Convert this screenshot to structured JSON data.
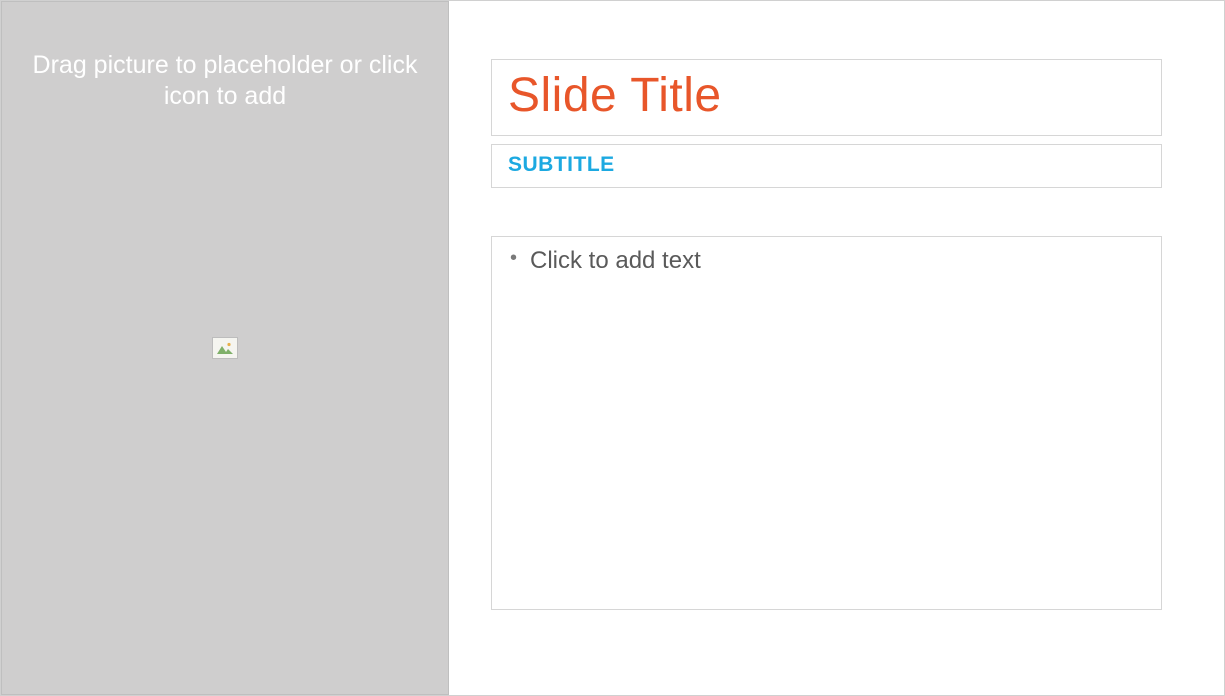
{
  "picture_placeholder": {
    "instruction": "Drag picture to placeholder or click icon to add",
    "icon_name": "image-icon"
  },
  "title": {
    "placeholder": "Slide Title"
  },
  "subtitle": {
    "placeholder": "SUBTITLE"
  },
  "body": {
    "placeholder": "Click to add text"
  },
  "colors": {
    "title_color": "#e8562a",
    "subtitle_color": "#1ca9e1",
    "placeholder_bg": "#cfcece",
    "body_text": "#5a5a5a"
  }
}
